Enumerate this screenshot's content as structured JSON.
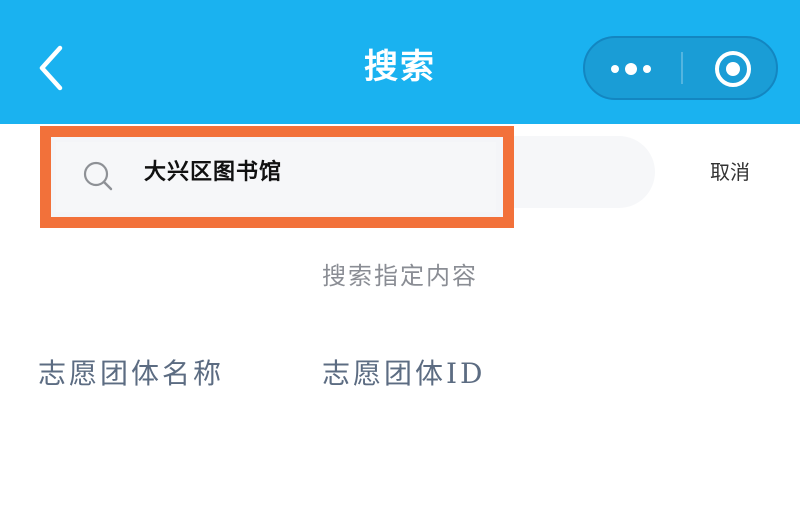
{
  "header": {
    "title": "搜索",
    "back_icon": "chevron-left-icon",
    "more_icon": "more-dots-icon",
    "close_icon": "target-circle-icon",
    "background_color": "#1ab2f0"
  },
  "search": {
    "value": "大兴区图书馆",
    "icon": "search-icon",
    "cancel_label": "取消",
    "highlight_color": "#f2713a"
  },
  "hint": {
    "text": "搜索指定内容"
  },
  "options": [
    {
      "label": "志愿团体名称"
    },
    {
      "label": "志愿团体ID"
    }
  ]
}
